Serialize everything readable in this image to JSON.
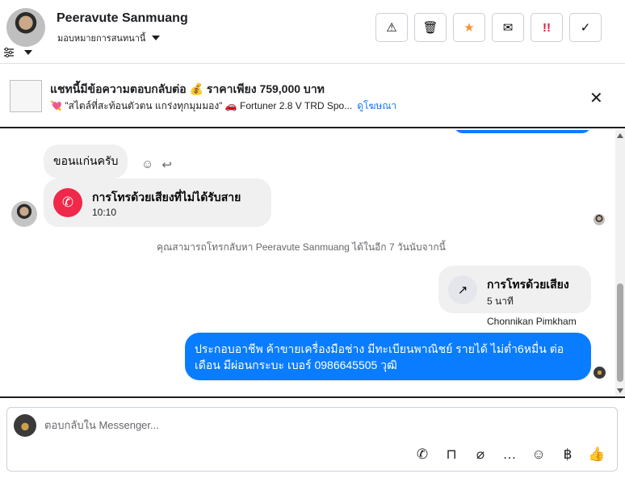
{
  "header": {
    "contact_name": "Peeravute Sanmuang",
    "assign_label": "มอบหมายการสนทนานี้",
    "actions": [
      {
        "name": "warning",
        "glyph": "⚠"
      },
      {
        "name": "trash",
        "glyph": "🗑"
      },
      {
        "name": "star",
        "glyph": "★",
        "color": "#f7923b"
      },
      {
        "name": "mail",
        "glyph": "✉"
      },
      {
        "name": "follow-up",
        "glyph": "!!",
        "color": "#e41e3f"
      },
      {
        "name": "done",
        "glyph": "✓"
      }
    ]
  },
  "banner": {
    "title": "แชทนี้มีข้อความตอบกลับต่อ 💰 ราคาเพียง 759,000 บาท",
    "subtitle": "💘 \"สไตล์ที่สะท้อนตัวตน แกร่งทุกมุมมอง\" 🚗 Fortuner 2.8 V TRD Spo...",
    "link": "ดูโฆษณา"
  },
  "messages": {
    "incoming_text": "ขอนแก่นครับ",
    "missed_call": {
      "title": "การโทรด้วยเสียงที่ไม่ได้รับสาย",
      "time": "10:10"
    },
    "system_note": "คุณสามารถโทรกลับหา Peeravute Sanmuang ได้ในอีก 7 วันนับจากนี้",
    "outgoing_call": {
      "title": "การโทรด้วยเสียง",
      "duration": "5 นาที"
    },
    "sender_name": "Chonnikan Pimkham",
    "outgoing_text": "ประกอบอาชีพ ค้าขายเครื่องมือช่าง มีทะเบียนพาณิชย์ รายได้ ไม่ต่ำ6หมื่น ต่อเดือน มีผ่อนกระบะ เบอร์ 0986645505 วุฒิ"
  },
  "composer": {
    "placeholder": "ตอบกลับใน Messenger..."
  },
  "colors": {
    "accent": "#0a7cff",
    "missed": "#f02849",
    "link": "#1877f2"
  }
}
